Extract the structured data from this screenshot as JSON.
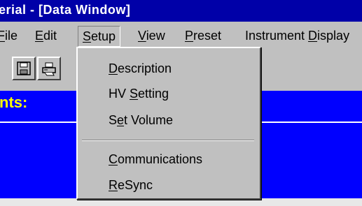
{
  "window": {
    "title": "erial - [Data Window]"
  },
  "menubar": {
    "items": [
      {
        "pre": "",
        "mn": "F",
        "post": "ile"
      },
      {
        "pre": "",
        "mn": "E",
        "post": "dit"
      },
      {
        "pre": "",
        "mn": "S",
        "post": "etup"
      },
      {
        "pre": "",
        "mn": "V",
        "post": "iew"
      },
      {
        "pre": "",
        "mn": "P",
        "post": "reset"
      },
      {
        "pre": "Instrument ",
        "mn": "D",
        "post": "isplay"
      }
    ]
  },
  "toolbar": {
    "buttons": [
      {
        "icon": "save-icon"
      },
      {
        "icon": "print-icon"
      }
    ]
  },
  "data_window": {
    "label": "nts:"
  },
  "setup_menu": {
    "items": [
      {
        "pre": "",
        "mn": "D",
        "post": "escription"
      },
      {
        "pre": "HV ",
        "mn": "S",
        "post": "etting"
      },
      {
        "pre": "S",
        "mn": "e",
        "post": "t Volume"
      },
      {
        "pre": "",
        "mn": "C",
        "post": "ommunications"
      },
      {
        "pre": "",
        "mn": "R",
        "post": "eSync"
      }
    ]
  },
  "colors": {
    "title_bar": "#0000a8",
    "data_area": "#0000ff",
    "data_label": "#ffff00",
    "chrome": "#c0c0c0"
  }
}
